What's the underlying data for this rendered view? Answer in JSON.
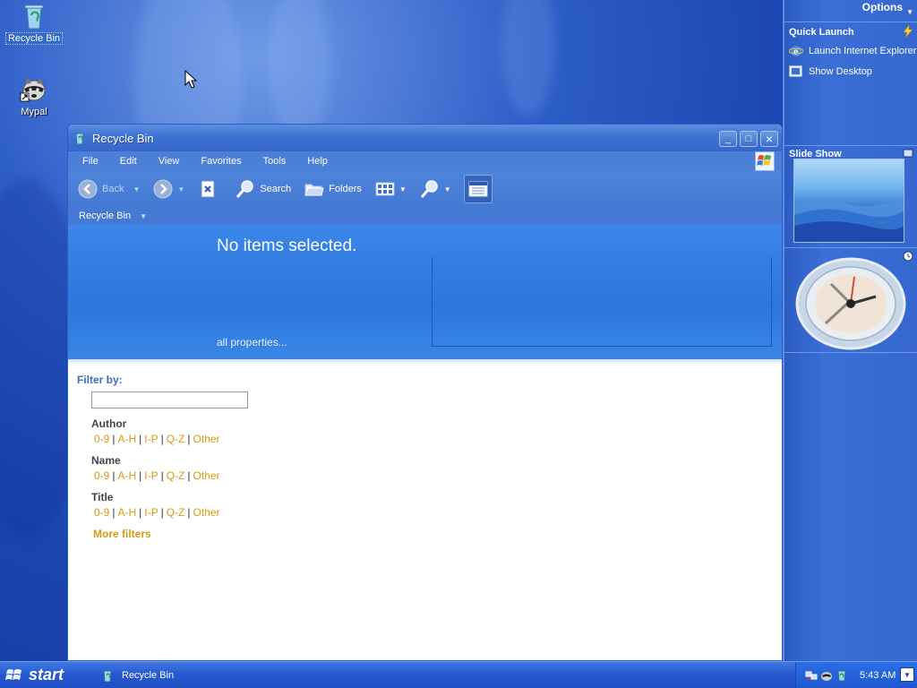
{
  "desktop": {
    "icons": [
      {
        "label": "Recycle Bin",
        "icon": "recycle-bin-icon"
      },
      {
        "label": "Mypal",
        "icon": "raccoon-icon"
      }
    ]
  },
  "window": {
    "title": "Recycle Bin",
    "controls": {
      "minimize": "_",
      "maximize": "□",
      "close": "×"
    },
    "menu": [
      "File",
      "Edit",
      "View",
      "Favorites",
      "Tools",
      "Help"
    ],
    "toolbar": {
      "back": "Back",
      "search": "Search",
      "folders": "Folders"
    },
    "address": "Recycle Bin",
    "details": {
      "headline": "No items selected.",
      "all_properties": "all properties..."
    },
    "filters": {
      "title": "Filter by:",
      "input_value": "",
      "groups": [
        {
          "name": "Author",
          "links": [
            "0-9",
            "A-H",
            "I-P",
            "Q-Z",
            "Other"
          ]
        },
        {
          "name": "Name",
          "links": [
            "0-9",
            "A-H",
            "I-P",
            "Q-Z",
            "Other"
          ]
        },
        {
          "name": "Title",
          "links": [
            "0-9",
            "A-H",
            "I-P",
            "Q-Z",
            "Other"
          ]
        }
      ],
      "separator": "|",
      "more": "More filters"
    }
  },
  "sidebar": {
    "options": "Options",
    "quick_launch": {
      "title": "Quick Launch",
      "items": [
        "Launch Internet Explorer",
        "Show Desktop"
      ]
    },
    "slideshow": {
      "title": "Slide Show"
    }
  },
  "taskbar": {
    "start": "start",
    "task": "Recycle Bin",
    "time": "5:43 AM"
  }
}
